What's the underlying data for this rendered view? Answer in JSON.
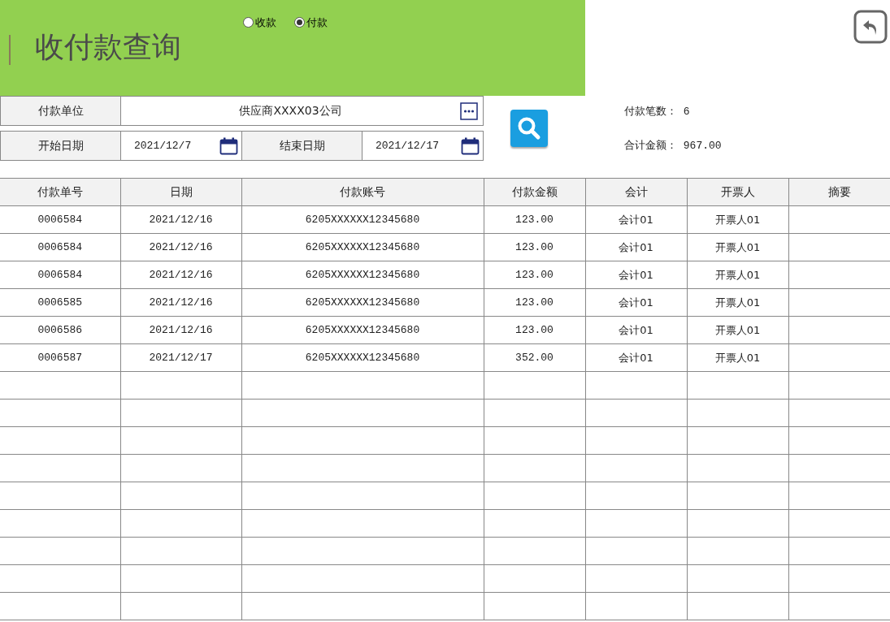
{
  "header": {
    "title": "收付款查询",
    "radios": [
      {
        "label": "收款",
        "selected": false
      },
      {
        "label": "付款",
        "selected": true
      }
    ]
  },
  "form": {
    "unit_label": "付款单位",
    "unit_value": "供应商XXXX03公司",
    "start_label": "开始日期",
    "start_value": "2021/12/7",
    "end_label": "结束日期",
    "end_value": "2021/12/17"
  },
  "summary": [
    "付款笔数： 6",
    "合计金额： 967.00"
  ],
  "table": {
    "columns": [
      "付款单号",
      "日期",
      "付款账号",
      "付款金额",
      "会计",
      "开票人",
      "摘要"
    ],
    "rows": [
      [
        "0006584",
        "2021/12/16",
        "6205XXXXXX12345680",
        "123.00",
        "会计01",
        "开票人01"
      ],
      [
        "0006584",
        "2021/12/16",
        "6205XXXXXX12345680",
        "123.00",
        "会计01",
        "开票人01"
      ],
      [
        "0006584",
        "2021/12/16",
        "6205XXXXXX12345680",
        "123.00",
        "会计01",
        "开票人01"
      ],
      [
        "0006585",
        "2021/12/16",
        "6205XXXXXX12345680",
        "123.00",
        "会计01",
        "开票人01"
      ],
      [
        "0006586",
        "2021/12/16",
        "6205XXXXXX12345680",
        "123.00",
        "会计01",
        "开票人01"
      ],
      [
        "0006587",
        "2021/12/17",
        "6205XXXXXX12345680",
        "352.00",
        "会计01",
        "开票人01"
      ]
    ]
  }
}
